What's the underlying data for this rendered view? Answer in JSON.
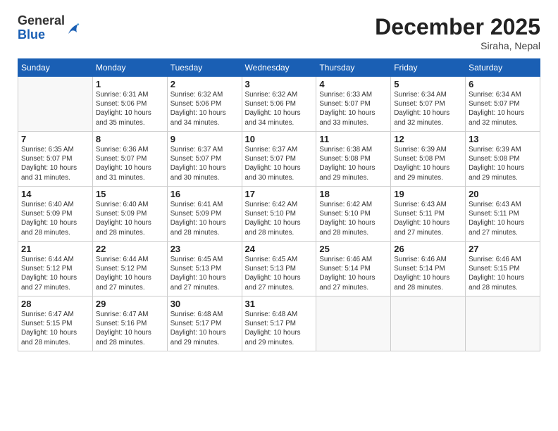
{
  "header": {
    "logo_general": "General",
    "logo_blue": "Blue",
    "month_title": "December 2025",
    "location": "Siraha, Nepal"
  },
  "weekdays": [
    "Sunday",
    "Monday",
    "Tuesday",
    "Wednesday",
    "Thursday",
    "Friday",
    "Saturday"
  ],
  "weeks": [
    [
      {
        "day": "",
        "detail": ""
      },
      {
        "day": "1",
        "detail": "Sunrise: 6:31 AM\nSunset: 5:06 PM\nDaylight: 10 hours\nand 35 minutes."
      },
      {
        "day": "2",
        "detail": "Sunrise: 6:32 AM\nSunset: 5:06 PM\nDaylight: 10 hours\nand 34 minutes."
      },
      {
        "day": "3",
        "detail": "Sunrise: 6:32 AM\nSunset: 5:06 PM\nDaylight: 10 hours\nand 34 minutes."
      },
      {
        "day": "4",
        "detail": "Sunrise: 6:33 AM\nSunset: 5:07 PM\nDaylight: 10 hours\nand 33 minutes."
      },
      {
        "day": "5",
        "detail": "Sunrise: 6:34 AM\nSunset: 5:07 PM\nDaylight: 10 hours\nand 32 minutes."
      },
      {
        "day": "6",
        "detail": "Sunrise: 6:34 AM\nSunset: 5:07 PM\nDaylight: 10 hours\nand 32 minutes."
      }
    ],
    [
      {
        "day": "7",
        "detail": "Sunrise: 6:35 AM\nSunset: 5:07 PM\nDaylight: 10 hours\nand 31 minutes."
      },
      {
        "day": "8",
        "detail": "Sunrise: 6:36 AM\nSunset: 5:07 PM\nDaylight: 10 hours\nand 31 minutes."
      },
      {
        "day": "9",
        "detail": "Sunrise: 6:37 AM\nSunset: 5:07 PM\nDaylight: 10 hours\nand 30 minutes."
      },
      {
        "day": "10",
        "detail": "Sunrise: 6:37 AM\nSunset: 5:07 PM\nDaylight: 10 hours\nand 30 minutes."
      },
      {
        "day": "11",
        "detail": "Sunrise: 6:38 AM\nSunset: 5:08 PM\nDaylight: 10 hours\nand 29 minutes."
      },
      {
        "day": "12",
        "detail": "Sunrise: 6:39 AM\nSunset: 5:08 PM\nDaylight: 10 hours\nand 29 minutes."
      },
      {
        "day": "13",
        "detail": "Sunrise: 6:39 AM\nSunset: 5:08 PM\nDaylight: 10 hours\nand 29 minutes."
      }
    ],
    [
      {
        "day": "14",
        "detail": "Sunrise: 6:40 AM\nSunset: 5:09 PM\nDaylight: 10 hours\nand 28 minutes."
      },
      {
        "day": "15",
        "detail": "Sunrise: 6:40 AM\nSunset: 5:09 PM\nDaylight: 10 hours\nand 28 minutes."
      },
      {
        "day": "16",
        "detail": "Sunrise: 6:41 AM\nSunset: 5:09 PM\nDaylight: 10 hours\nand 28 minutes."
      },
      {
        "day": "17",
        "detail": "Sunrise: 6:42 AM\nSunset: 5:10 PM\nDaylight: 10 hours\nand 28 minutes."
      },
      {
        "day": "18",
        "detail": "Sunrise: 6:42 AM\nSunset: 5:10 PM\nDaylight: 10 hours\nand 28 minutes."
      },
      {
        "day": "19",
        "detail": "Sunrise: 6:43 AM\nSunset: 5:11 PM\nDaylight: 10 hours\nand 27 minutes."
      },
      {
        "day": "20",
        "detail": "Sunrise: 6:43 AM\nSunset: 5:11 PM\nDaylight: 10 hours\nand 27 minutes."
      }
    ],
    [
      {
        "day": "21",
        "detail": "Sunrise: 6:44 AM\nSunset: 5:12 PM\nDaylight: 10 hours\nand 27 minutes."
      },
      {
        "day": "22",
        "detail": "Sunrise: 6:44 AM\nSunset: 5:12 PM\nDaylight: 10 hours\nand 27 minutes."
      },
      {
        "day": "23",
        "detail": "Sunrise: 6:45 AM\nSunset: 5:13 PM\nDaylight: 10 hours\nand 27 minutes."
      },
      {
        "day": "24",
        "detail": "Sunrise: 6:45 AM\nSunset: 5:13 PM\nDaylight: 10 hours\nand 27 minutes."
      },
      {
        "day": "25",
        "detail": "Sunrise: 6:46 AM\nSunset: 5:14 PM\nDaylight: 10 hours\nand 27 minutes."
      },
      {
        "day": "26",
        "detail": "Sunrise: 6:46 AM\nSunset: 5:14 PM\nDaylight: 10 hours\nand 28 minutes."
      },
      {
        "day": "27",
        "detail": "Sunrise: 6:46 AM\nSunset: 5:15 PM\nDaylight: 10 hours\nand 28 minutes."
      }
    ],
    [
      {
        "day": "28",
        "detail": "Sunrise: 6:47 AM\nSunset: 5:15 PM\nDaylight: 10 hours\nand 28 minutes."
      },
      {
        "day": "29",
        "detail": "Sunrise: 6:47 AM\nSunset: 5:16 PM\nDaylight: 10 hours\nand 28 minutes."
      },
      {
        "day": "30",
        "detail": "Sunrise: 6:48 AM\nSunset: 5:17 PM\nDaylight: 10 hours\nand 29 minutes."
      },
      {
        "day": "31",
        "detail": "Sunrise: 6:48 AM\nSunset: 5:17 PM\nDaylight: 10 hours\nand 29 minutes."
      },
      {
        "day": "",
        "detail": ""
      },
      {
        "day": "",
        "detail": ""
      },
      {
        "day": "",
        "detail": ""
      }
    ]
  ]
}
